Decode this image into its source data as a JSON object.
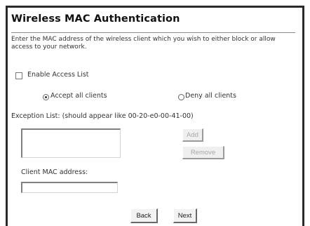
{
  "page": {
    "title": "Wireless MAC Authentication",
    "description": "Enter the MAC address of the wireless client which you wish to either block or allow access to your network."
  },
  "access_list": {
    "enable_label": "Enable Access List",
    "enabled": false
  },
  "policy": {
    "accept_label": "Accept all clients",
    "deny_label": "Deny all clients",
    "selected": "accept"
  },
  "exception_list": {
    "label": "Exception List: (should appear like 00-20-e0-00-41-00)",
    "items": []
  },
  "buttons": {
    "add": "Add",
    "remove": "Remove",
    "back": "Back",
    "next": "Next"
  },
  "client_mac": {
    "label": "Client MAC address:",
    "value": ""
  }
}
